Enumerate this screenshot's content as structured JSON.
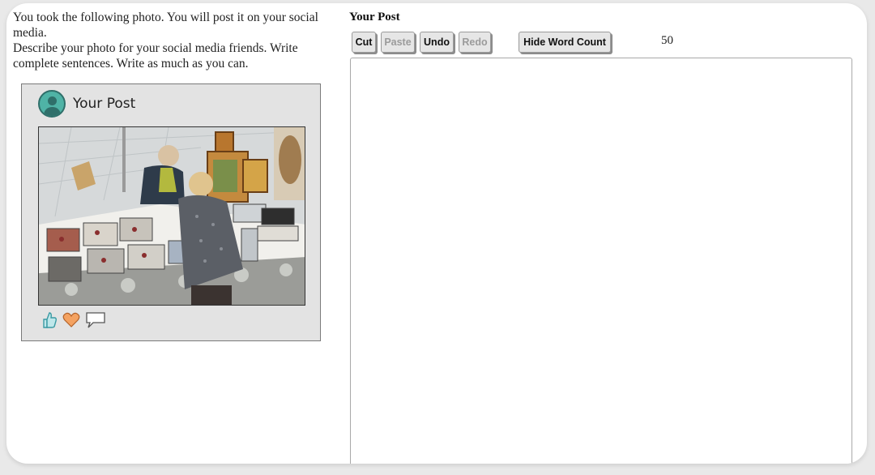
{
  "prompt": {
    "line1": "You took the following photo.  You will post it on your social media.",
    "line2": "Describe your photo for your social media friends.  Write complete sentences.  Write as much as you can."
  },
  "post_card": {
    "title": "Your Post",
    "avatar_icon": "user-avatar-icon",
    "reactions": [
      "thumbs-up-icon",
      "heart-icon",
      "comment-icon"
    ]
  },
  "editor": {
    "title": "Your Post",
    "buttons": {
      "cut": "Cut",
      "paste": "Paste",
      "undo": "Undo",
      "redo": "Redo",
      "hide_word_count": "Hide Word Count"
    },
    "disabled": [
      "paste",
      "redo"
    ],
    "word_count": "50",
    "text_value": ""
  },
  "colors": {
    "card_bg": "#ffffff",
    "post_bg": "#e3e3e3",
    "avatar": "#4fb3a6",
    "heart": "#f4a261",
    "thumb": "#6cc3c9"
  }
}
